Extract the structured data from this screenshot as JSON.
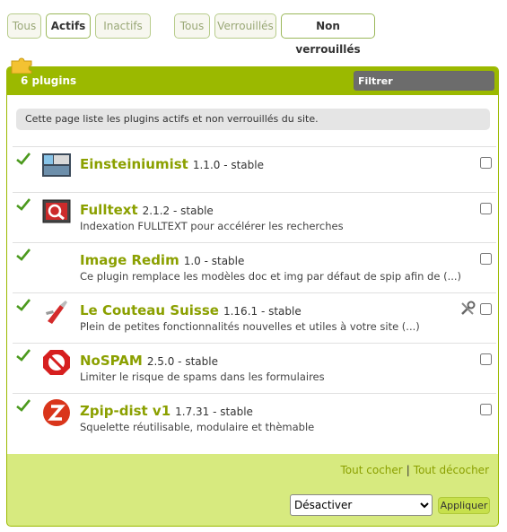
{
  "tabs_status": [
    {
      "label": "Tous"
    },
    {
      "label": "Actifs"
    },
    {
      "label": "Inactifs"
    }
  ],
  "tabs_lock": [
    {
      "label": "Tous"
    },
    {
      "label": "Verrouillés"
    },
    {
      "label": "Non verrouillés"
    }
  ],
  "box": {
    "title": "6 plugins",
    "filter_placeholder": "Filtrer",
    "info": "Cette page liste les plugins actifs et non verrouillés du site."
  },
  "plugins": [
    {
      "name": "Einsteiniumist",
      "version": "1.1.0 - stable",
      "description": "",
      "logo": "einsteiniumist-logo",
      "checked": false
    },
    {
      "name": "Fulltext",
      "version": "2.1.2 - stable",
      "description": "Indexation FULLTEXT pour accélérer les recherches",
      "logo": "fulltext-logo",
      "checked": false
    },
    {
      "name": "Image Redim",
      "version": "1.0 - stable",
      "description": "Ce plugin remplace les modèles doc et img par défaut de spip afin de (...)",
      "logo": "",
      "checked": false
    },
    {
      "name": "Le Couteau Suisse",
      "version": "1.16.1 - stable",
      "description": "Plein de petites fonctionnalités nouvelles et utiles à votre site (...)",
      "logo": "couteau-suisse-logo",
      "checked": false,
      "has_config": true
    },
    {
      "name": "NoSPAM",
      "version": "2.5.0 - stable",
      "description": "Limiter le risque de spams dans les formulaires",
      "logo": "nospam-logo",
      "checked": false
    },
    {
      "name": "Zpip-dist v1",
      "version": "1.7.31 - stable",
      "description": "Squelette réutilisable, modulaire et thèmable",
      "logo": "zpip-logo",
      "checked": false
    }
  ],
  "footer": {
    "check_all": "Tout cocher",
    "separator": "|",
    "uncheck_all": "Tout décocher",
    "action_selected": "Désactiver",
    "apply_label": "Appliquer"
  },
  "colors": {
    "accent": "#9bb900",
    "panel_bg": "#d7ea7f",
    "plugin_name": "#8ba000"
  }
}
